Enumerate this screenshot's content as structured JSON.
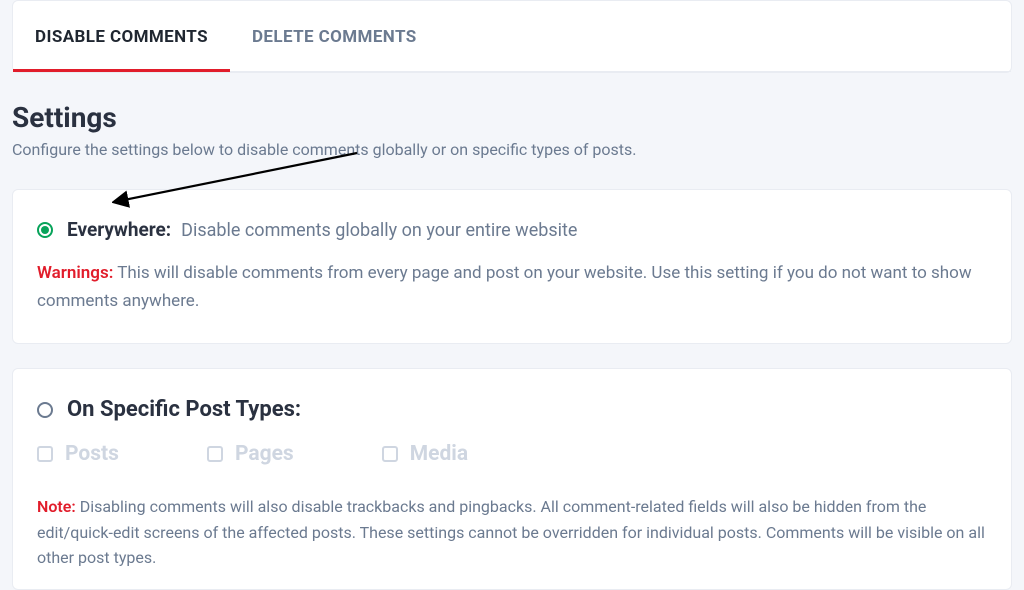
{
  "tabs": {
    "disable": "DISABLE COMMENTS",
    "delete": "DELETE COMMENTS"
  },
  "heading": {
    "title": "Settings",
    "subtitle": "Configure the settings below to disable comments globally or on specific types of posts."
  },
  "option_everywhere": {
    "title": "Everywhere:",
    "desc": "Disable comments globally on your entire website",
    "warning_label": "Warnings:",
    "warning_text": "This will disable comments from every page and post on your website. Use this setting if you do not want to show comments anywhere."
  },
  "option_specific": {
    "title": "On Specific Post Types:",
    "checkboxes": {
      "posts": "Posts",
      "pages": "Pages",
      "media": "Media"
    },
    "note_label": "Note:",
    "note_text": "Disabling comments will also disable trackbacks and pingbacks. All comment-related fields will also be hidden from the edit/quick-edit screens of the affected posts. These settings cannot be overridden for individual posts. Comments will be visible on all other post types."
  }
}
